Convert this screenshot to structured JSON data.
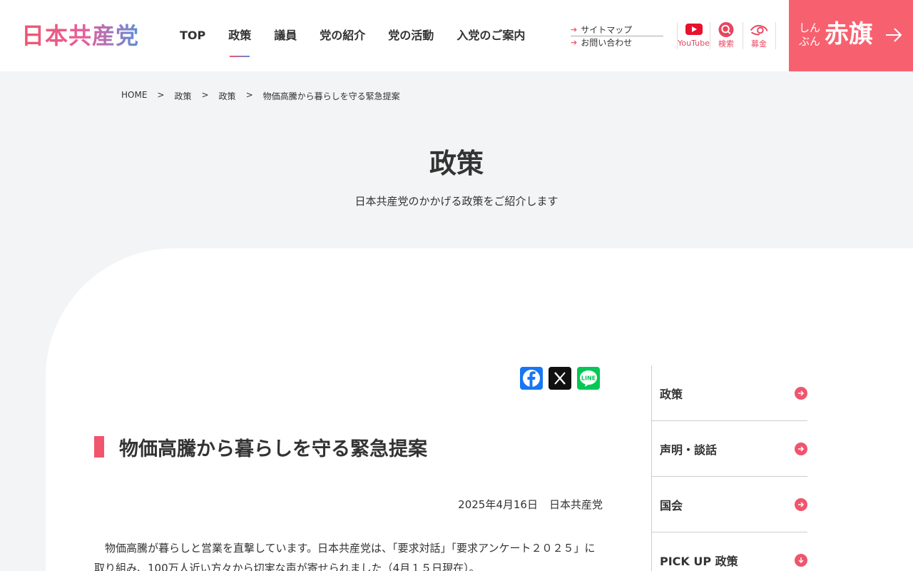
{
  "header": {
    "logo": "日本共産党",
    "nav": [
      "TOP",
      "政策",
      "議員",
      "党の紹介",
      "党の活動",
      "入党のご案内"
    ],
    "active_nav": "政策",
    "util_links": [
      "サイトマップ",
      "お問い合わせ"
    ],
    "icons": [
      {
        "name": "youtube-icon",
        "label": "YouTube"
      },
      {
        "name": "search-icon",
        "label": "検索"
      },
      {
        "name": "donation-icon",
        "label": "募金"
      }
    ],
    "akahata": {
      "small": "しん\nぶん",
      "big": "赤旗"
    }
  },
  "breadcrumb": [
    "HOME",
    "政策",
    "政策",
    "物価高騰から暮らしを守る緊急提案"
  ],
  "hero": {
    "title": "政策",
    "subtitle": "日本共産党のかかげる政策をご紹介します"
  },
  "share": [
    "Facebook",
    "X",
    "LINE"
  ],
  "article": {
    "title": "物価高騰から暮らしを守る緊急提案",
    "date": "2025年4月16日",
    "author": "日本共産党",
    "body": "　物価高騰が暮らしと営業を直撃しています。日本共産党は、「要求対話」「要求アンケート２０２５」に取り組み、100万人近い方々から切実な声が寄せられました（4月１５日現在）。"
  },
  "sidebar": [
    "政策",
    "声明・談話",
    "国会",
    "PICK UP 政策"
  ],
  "colors": {
    "accent": "#f0556d",
    "akahata_bg": "#f7616f",
    "youtube": "#e8112d",
    "facebook": "#1877f2",
    "line": "#06c755"
  }
}
